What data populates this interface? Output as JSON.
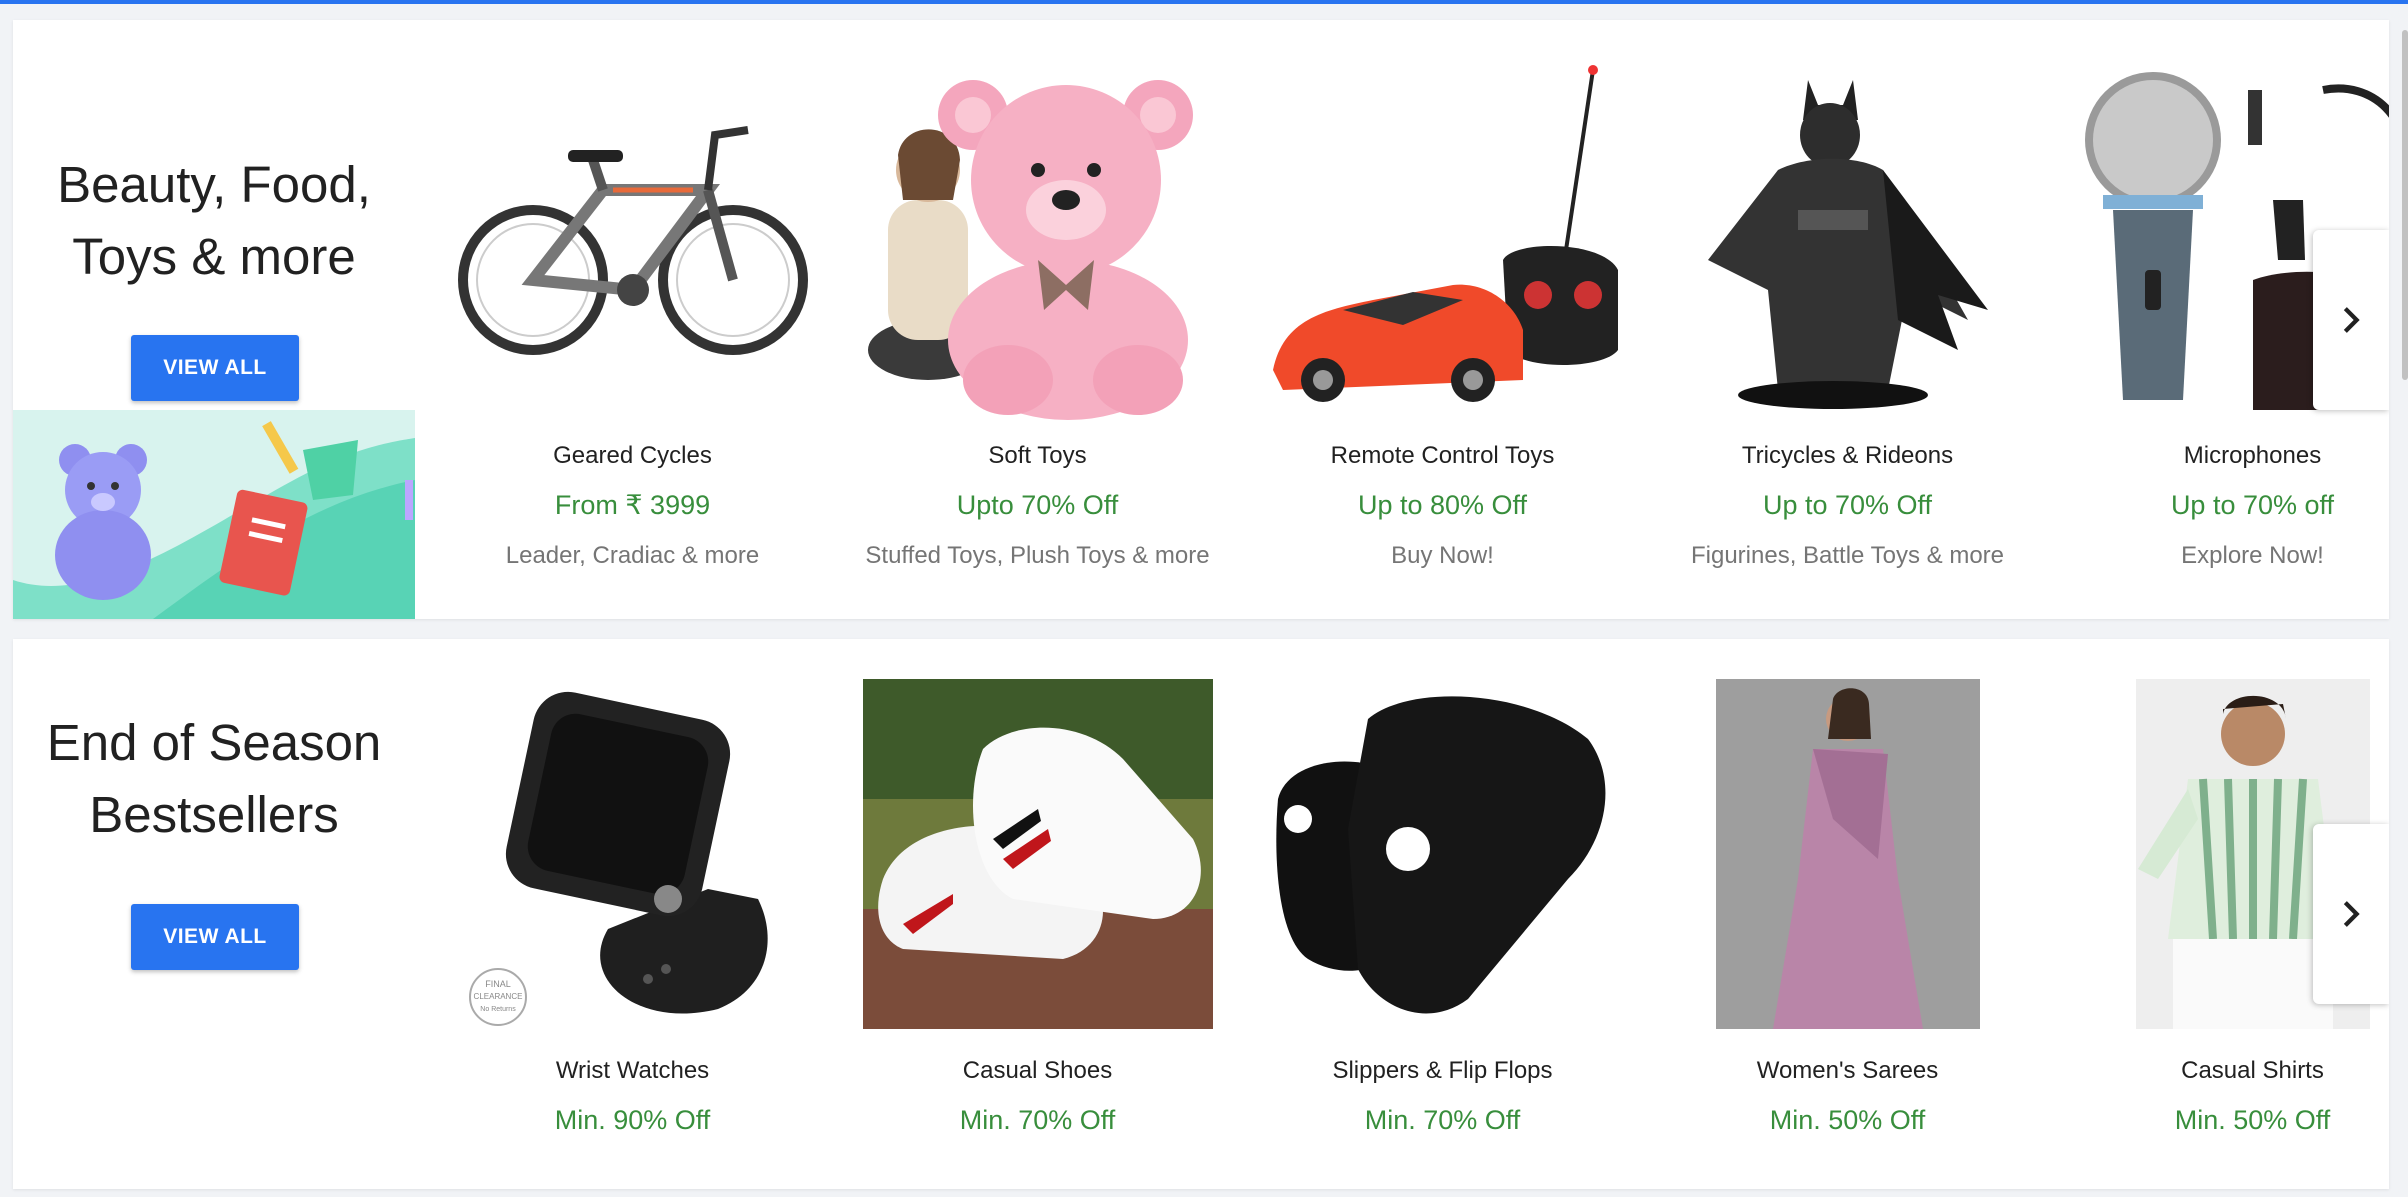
{
  "colors": {
    "accent": "#2874f0",
    "offer": "#388e3c",
    "muted": "#757575",
    "text": "#212121"
  },
  "sections": [
    {
      "title_line1": "Beauty, Food,",
      "title_line2": "Toys & more",
      "view_all_label": "VIEW ALL",
      "cards": [
        {
          "name": "Geared Cycles",
          "offer": "From ₹ 3999",
          "sub": "Leader, Cradiac & more",
          "icon": "bicycle-image"
        },
        {
          "name": "Soft Toys",
          "offer": "Upto 70% Off",
          "sub": "Stuffed Toys, Plush Toys & more",
          "icon": "teddy-bear-image"
        },
        {
          "name": "Remote Control Toys",
          "offer": "Up to 80% Off",
          "sub": "Buy Now!",
          "icon": "rc-car-image"
        },
        {
          "name": "Tricycles & Rideons",
          "offer": "Up to 70% Off",
          "sub": "Figurines, Battle Toys & more",
          "icon": "figurine-image"
        },
        {
          "name": "Microphones",
          "offer": "Up to 70% off",
          "sub": "Explore Now!",
          "icon": "microphone-image"
        }
      ]
    },
    {
      "title_line1": "End of Season",
      "title_line2": "Bestsellers",
      "view_all_label": "VIEW ALL",
      "cards": [
        {
          "name": "Wrist Watches",
          "offer": "Min. 90% Off",
          "icon": "watch-image",
          "badge_line1": "FINAL",
          "badge_line2": "CLEARANCE",
          "badge_line3": "No Returns"
        },
        {
          "name": "Casual Shoes",
          "offer": "Min. 70% Off",
          "icon": "sneaker-image"
        },
        {
          "name": "Slippers & Flip Flops",
          "offer": "Min. 70% Off",
          "icon": "slides-image"
        },
        {
          "name": "Women's Sarees",
          "offer": "Min. 50% Off",
          "icon": "saree-image"
        },
        {
          "name": "Casual Shirts",
          "offer": "Min. 50% Off",
          "icon": "shirt-image"
        }
      ]
    }
  ]
}
